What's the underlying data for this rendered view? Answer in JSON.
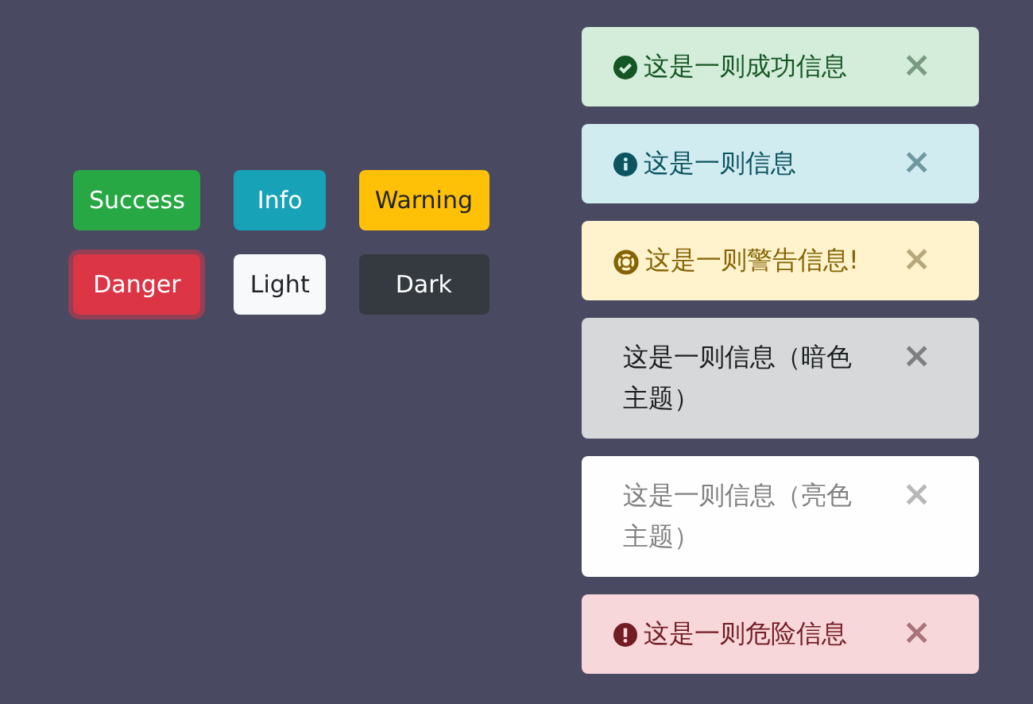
{
  "buttons": [
    {
      "label": "Success",
      "kind": "success",
      "focused": false
    },
    {
      "label": "Info",
      "kind": "info",
      "focused": false
    },
    {
      "label": "Warning",
      "kind": "warning",
      "focused": false
    },
    {
      "label": "Danger",
      "kind": "danger",
      "focused": true
    },
    {
      "label": "Light",
      "kind": "light",
      "focused": false
    },
    {
      "label": "Dark",
      "kind": "dark",
      "focused": false
    }
  ],
  "alerts": [
    {
      "kind": "success",
      "text": "这是一则成功信息",
      "close": "×"
    },
    {
      "kind": "info",
      "text": "这是一则信息",
      "close": "×"
    },
    {
      "kind": "warning",
      "text": "这是一则警告信息!",
      "close": "×"
    },
    {
      "kind": "dark",
      "text": "这是一则信息（暗色主题）",
      "close": "×"
    },
    {
      "kind": "light",
      "text": "这是一则信息（亮色主题）",
      "close": "×"
    },
    {
      "kind": "danger",
      "text": "这是一则危险信息",
      "close": "×"
    }
  ]
}
